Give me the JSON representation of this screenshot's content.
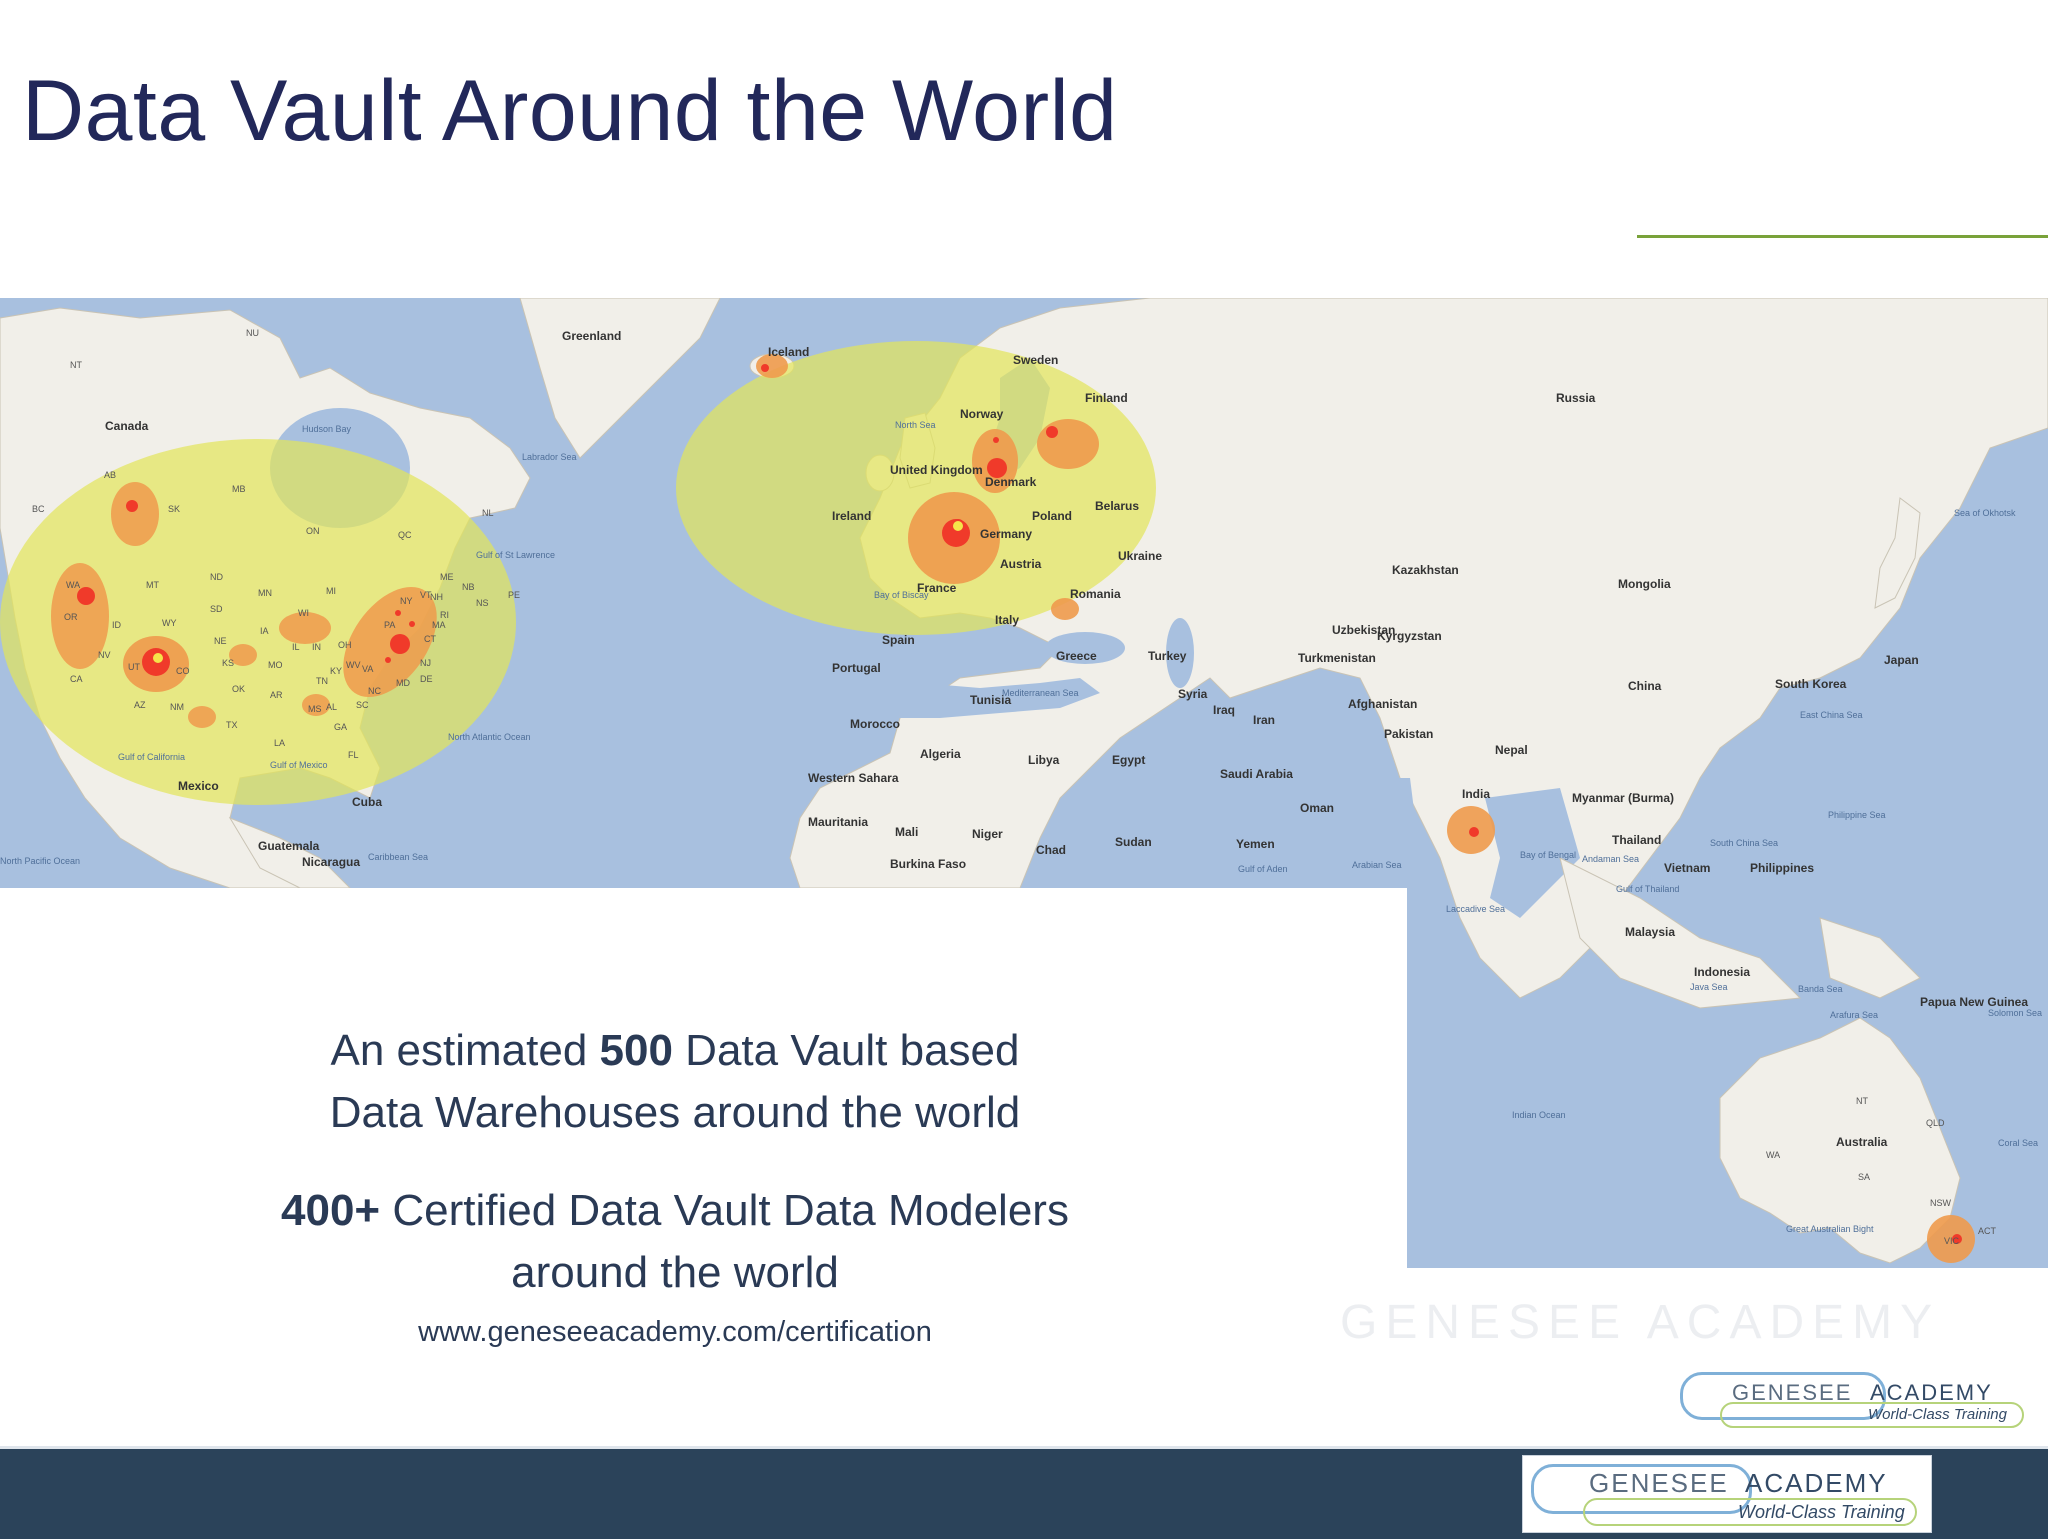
{
  "slide": {
    "title": "Data Vault Around the World"
  },
  "body": {
    "line1_pre": "An estimated ",
    "line1_bold": "500",
    "line1_post": " Data Vault based",
    "line2": "Data Warehouses around the world",
    "line3_bold": "400+",
    "line3_post": " Certified Data Vault Data Modelers",
    "line4": "around the world",
    "url": "www.geneseeacademy.com/certification"
  },
  "logo": {
    "word1": "GENESEE",
    "word2": "ACADEMY",
    "tagline": "World-Class Training"
  },
  "watermark": "GENESEE  ACADEMY",
  "map": {
    "country_labels": {
      "canada": "Canada",
      "greenland": "Greenland",
      "iceland": "Iceland",
      "sweden": "Sweden",
      "finland": "Finland",
      "norway": "Norway",
      "uk": "United Kingdom",
      "ireland": "Ireland",
      "poland": "Poland",
      "belarus": "Belarus",
      "ukraine": "Ukraine",
      "france": "France",
      "germany": "Germany",
      "spain": "Spain",
      "portugal": "Portugal",
      "italy": "Italy",
      "romania": "Romania",
      "greece": "Greece",
      "turkey": "Turkey",
      "russia": "Russia",
      "kazakhstan": "Kazakhstan",
      "mongolia": "Mongolia",
      "china": "China",
      "japan": "Japan",
      "south_korea": "South Korea",
      "uzbekistan": "Uzbekistan",
      "kyrgyzstan": "Kyrgyzstan",
      "turkmenistan": "Turkmenistan",
      "afghanistan": "Afghanistan",
      "pakistan": "Pakistan",
      "iran": "Iran",
      "iraq": "Iraq",
      "syria": "Syria",
      "saudi": "Saudi Arabia",
      "yemen": "Yemen",
      "oman": "Oman",
      "egypt": "Egypt",
      "libya": "Libya",
      "algeria": "Algeria",
      "morocco": "Morocco",
      "tunisia": "Tunisia",
      "western_sahara": "Western Sahara",
      "mauritania": "Mauritania",
      "mali": "Mali",
      "niger": "Niger",
      "chad": "Chad",
      "sudan": "Sudan",
      "burkina": "Burkina Faso",
      "india": "India",
      "nepal": "Nepal",
      "myanmar": "Myanmar (Burma)",
      "thailand": "Thailand",
      "vietnam": "Vietnam",
      "philippines": "Philippines",
      "malaysia": "Malaysia",
      "indonesia": "Indonesia",
      "papua": "Papua New Guinea",
      "australia": "Australia",
      "mexico": "Mexico",
      "cuba": "Cuba",
      "guatemala": "Guatemala",
      "nicaragua": "Nicaragua",
      "denmark": "Denmark",
      "austria": "Austria"
    },
    "sea_labels": {
      "labrador": "Labrador Sea",
      "hudson": "Hudson Bay",
      "gulf_st_lawrence": "Gulf of St Lawrence",
      "north_atlantic": "North Atlantic Ocean",
      "north_pacific": "North Pacific Ocean",
      "gulf_california": "Gulf of California",
      "gulf_mexico": "Gulf of Mexico",
      "caribbean": "Caribbean Sea",
      "north_sea": "North Sea",
      "bay_biscay": "Bay of Biscay",
      "mediterranean": "Mediterranean Sea",
      "arabian": "Arabian Sea",
      "bay_bengal": "Bay of Bengal",
      "andaman": "Andaman Sea",
      "gulf_thailand": "Gulf of Thailand",
      "south_china": "South China Sea",
      "east_china": "East China Sea",
      "philippine": "Philippine Sea",
      "sea_okhotsk": "Sea of Okhotsk",
      "laccadive": "Laccadive Sea",
      "indian_ocean": "Indian Ocean",
      "java": "Java Sea",
      "banda": "Banda Sea",
      "arafura": "Arafura Sea",
      "solomon": "Solomon Sea",
      "coral": "Coral Sea",
      "great_australian_bight": "Great Australian Bight",
      "gulf_aden": "Gulf of Aden"
    },
    "state_labels": [
      "NU",
      "NT",
      "AB",
      "SK",
      "MB",
      "BC",
      "ON",
      "QC",
      "NL",
      "WA",
      "OR",
      "CA",
      "NV",
      "ID",
      "MT",
      "WY",
      "UT",
      "CO",
      "AZ",
      "NM",
      "ND",
      "SD",
      "NE",
      "KS",
      "OK",
      "TX",
      "MN",
      "IA",
      "MO",
      "AR",
      "LA",
      "WI",
      "IL",
      "MI",
      "IN",
      "OH",
      "KY",
      "TN",
      "MS",
      "AL",
      "GA",
      "FL",
      "SC",
      "NC",
      "VA",
      "WV",
      "PA",
      "NY",
      "VT",
      "NH",
      "ME",
      "MA",
      "CT",
      "NJ",
      "MD",
      "DE",
      "RI",
      "NB",
      "NS",
      "PE",
      "QLD",
      "NSW",
      "VIC",
      "ACT",
      "SA",
      "NT",
      "WA"
    ]
  },
  "colors": {
    "title": "#22285a",
    "accent_line": "#79a23a",
    "ocean": "#a8c0df",
    "land": "#f1efe9",
    "region_yellow": "#e8eb6a",
    "cluster_orange": "#ee9a4c",
    "dot_red": "#f03a2a",
    "footer": "#2b435a"
  }
}
